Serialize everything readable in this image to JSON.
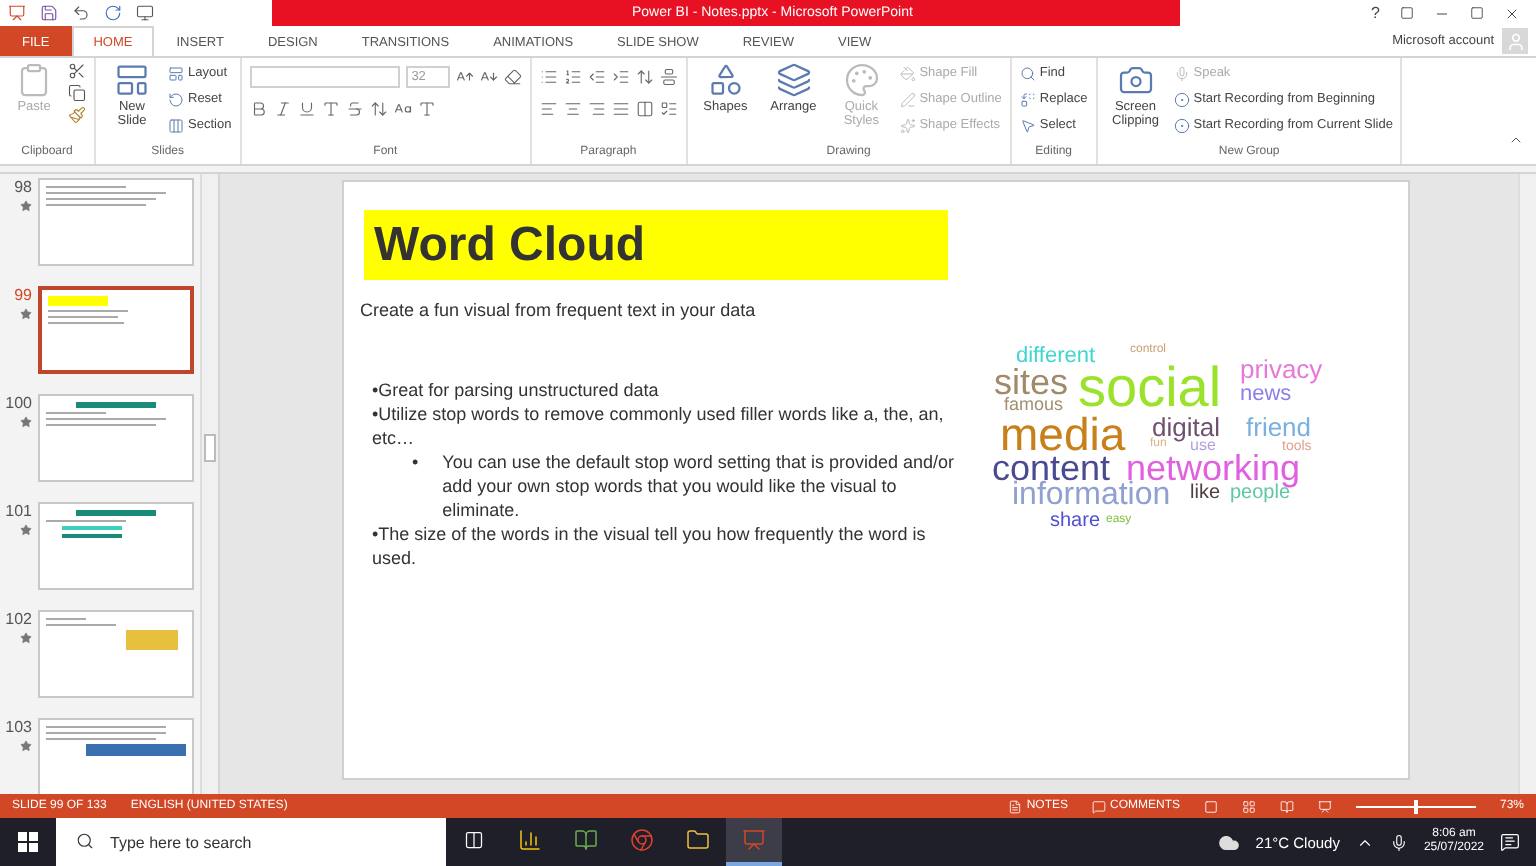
{
  "title_bar": {
    "title": "Power BI - Notes.pptx - Microsoft PowerPoint",
    "help": "?"
  },
  "ribbon_tabs": [
    {
      "label": "FILE",
      "kind": "file",
      "selected": false
    },
    {
      "label": "HOME",
      "kind": "tab",
      "selected": true
    },
    {
      "label": "INSERT",
      "kind": "tab",
      "selected": false
    },
    {
      "label": "DESIGN",
      "kind": "tab",
      "selected": false
    },
    {
      "label": "TRANSITIONS",
      "kind": "tab",
      "selected": false
    },
    {
      "label": "ANIMATIONS",
      "kind": "tab",
      "selected": false
    },
    {
      "label": "SLIDE SHOW",
      "kind": "tab",
      "selected": false
    },
    {
      "label": "REVIEW",
      "kind": "tab",
      "selected": false
    },
    {
      "label": "VIEW",
      "kind": "tab",
      "selected": false
    }
  ],
  "account": "Microsoft account",
  "ribbon": {
    "groups": [
      {
        "label": "Clipboard",
        "kind": "buttons",
        "large": [
          {
            "label": "Paste",
            "disabled": true
          }
        ]
      },
      {
        "label": "Slides",
        "kind": "buttons",
        "large": [
          {
            "label": "New Slide",
            "disabled": false
          }
        ],
        "small": [
          {
            "label": "Layout",
            "disabled": false
          },
          {
            "label": "Reset",
            "disabled": false
          },
          {
            "label": "Section",
            "disabled": false
          }
        ]
      },
      {
        "label": "Font",
        "kind": "font",
        "font_size": "32"
      },
      {
        "label": "Paragraph",
        "kind": "paragraph"
      },
      {
        "label": "Drawing",
        "kind": "buttons",
        "large": [
          {
            "label": "Shapes",
            "disabled": false
          },
          {
            "label": "Arrange",
            "disabled": false
          },
          {
            "label": "Quick Styles",
            "disabled": true
          }
        ],
        "small": [
          {
            "label": "Shape Fill",
            "disabled": true
          },
          {
            "label": "Shape Outline",
            "disabled": true
          },
          {
            "label": "Shape Effects",
            "disabled": true
          }
        ]
      },
      {
        "label": "Editing",
        "kind": "buttons",
        "small": [
          {
            "label": "Find",
            "disabled": false
          },
          {
            "label": "Replace",
            "disabled": false
          },
          {
            "label": "Select",
            "disabled": false
          }
        ]
      },
      {
        "label": "New Group",
        "kind": "buttons",
        "large": [
          {
            "label": "Screen Clipping",
            "disabled": false
          }
        ],
        "small": [
          {
            "label": "Speak",
            "disabled": true
          },
          {
            "label": "Start Recording from Beginning",
            "disabled": false
          },
          {
            "label": "Start Recording from Current Slide",
            "disabled": false
          }
        ]
      }
    ]
  },
  "thumbnails": [
    {
      "number": "98",
      "selected": false
    },
    {
      "number": "99",
      "selected": true
    },
    {
      "number": "100",
      "selected": false
    },
    {
      "number": "101",
      "selected": false
    },
    {
      "number": "102",
      "selected": false
    },
    {
      "number": "103",
      "selected": false
    }
  ],
  "slide": {
    "title": "Word Cloud",
    "subtitle": "Create a fun visual from frequent text in your data",
    "bullets": [
      {
        "text": "•Great for parsing unstructured data"
      },
      {
        "text": "•Utilize stop words to remove commonly used filler words like a, the, an, etc…",
        "children": [
          {
            "marker": "•",
            "text": "You can use the default stop word setting that is provided and/or add your own stop words that you would like the visual to eliminate."
          }
        ]
      },
      {
        "text": "•The size of the words in the visual tell you how frequently the word is used."
      }
    ],
    "word_cloud": [
      {
        "word": "different",
        "color": "#3dd6d0"
      },
      {
        "word": "control",
        "color": "#c8a070"
      },
      {
        "word": "sites",
        "color": "#a08a6a"
      },
      {
        "word": "social",
        "color": "#9be22a"
      },
      {
        "word": "privacy",
        "color": "#e878d8"
      },
      {
        "word": "news",
        "color": "#8a80e8"
      },
      {
        "word": "famous",
        "color": "#a09070"
      },
      {
        "word": "media",
        "color": "#c8801a"
      },
      {
        "word": "digital",
        "color": "#705070"
      },
      {
        "word": "friend",
        "color": "#7ab0e0"
      },
      {
        "word": "fun",
        "color": "#e0b080"
      },
      {
        "word": "use",
        "color": "#b0a0e0"
      },
      {
        "word": "tools",
        "color": "#e0a090"
      },
      {
        "word": "content",
        "color": "#4a4a90"
      },
      {
        "word": "networking",
        "color": "#e060e0"
      },
      {
        "word": "information",
        "color": "#90a0d0"
      },
      {
        "word": "like",
        "color": "#504040"
      },
      {
        "word": "people",
        "color": "#60c8a0"
      },
      {
        "word": "share",
        "color": "#5050d0"
      },
      {
        "word": "easy",
        "color": "#80c040"
      }
    ]
  },
  "status_bar": {
    "slide_info": "SLIDE 99 OF 133",
    "language": "ENGLISH (UNITED STATES)",
    "notes": "NOTES",
    "comments": "COMMENTS",
    "zoom": {
      "level": 0.5,
      "reading": "73%"
    }
  },
  "taskbar": {
    "search_placeholder": "Type here to search",
    "apps": [
      {
        "selected": false
      },
      {
        "selected": false
      },
      {
        "selected": false
      },
      {
        "selected": false
      },
      {
        "selected": true
      }
    ],
    "weather": "21°C Cloudy",
    "time": "8:06 am",
    "date": "25/07/2022"
  }
}
